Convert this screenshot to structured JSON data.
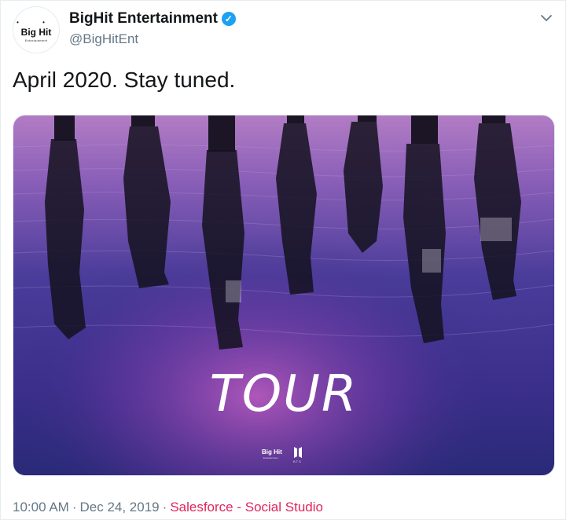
{
  "account": {
    "display_name": "BigHit Entertainment",
    "handle": "@BigHitEnt",
    "avatar_text": "Big Hit",
    "avatar_subtext": "Entertainment",
    "verified": true
  },
  "tweet": {
    "text": "April 2020. Stay tuned."
  },
  "media": {
    "title": "TOUR",
    "logo_left": "Big Hit",
    "logo_left_sub": "Entertainment",
    "logo_right_sub": "BTS"
  },
  "footer": {
    "time": "10:00 AM",
    "separator1": "·",
    "date": "Dec 24, 2019",
    "separator2": "·",
    "source": "Salesforce - Social Studio"
  },
  "colors": {
    "accent": "#1da1f2",
    "source_link": "#e0245e",
    "muted": "#657786"
  }
}
